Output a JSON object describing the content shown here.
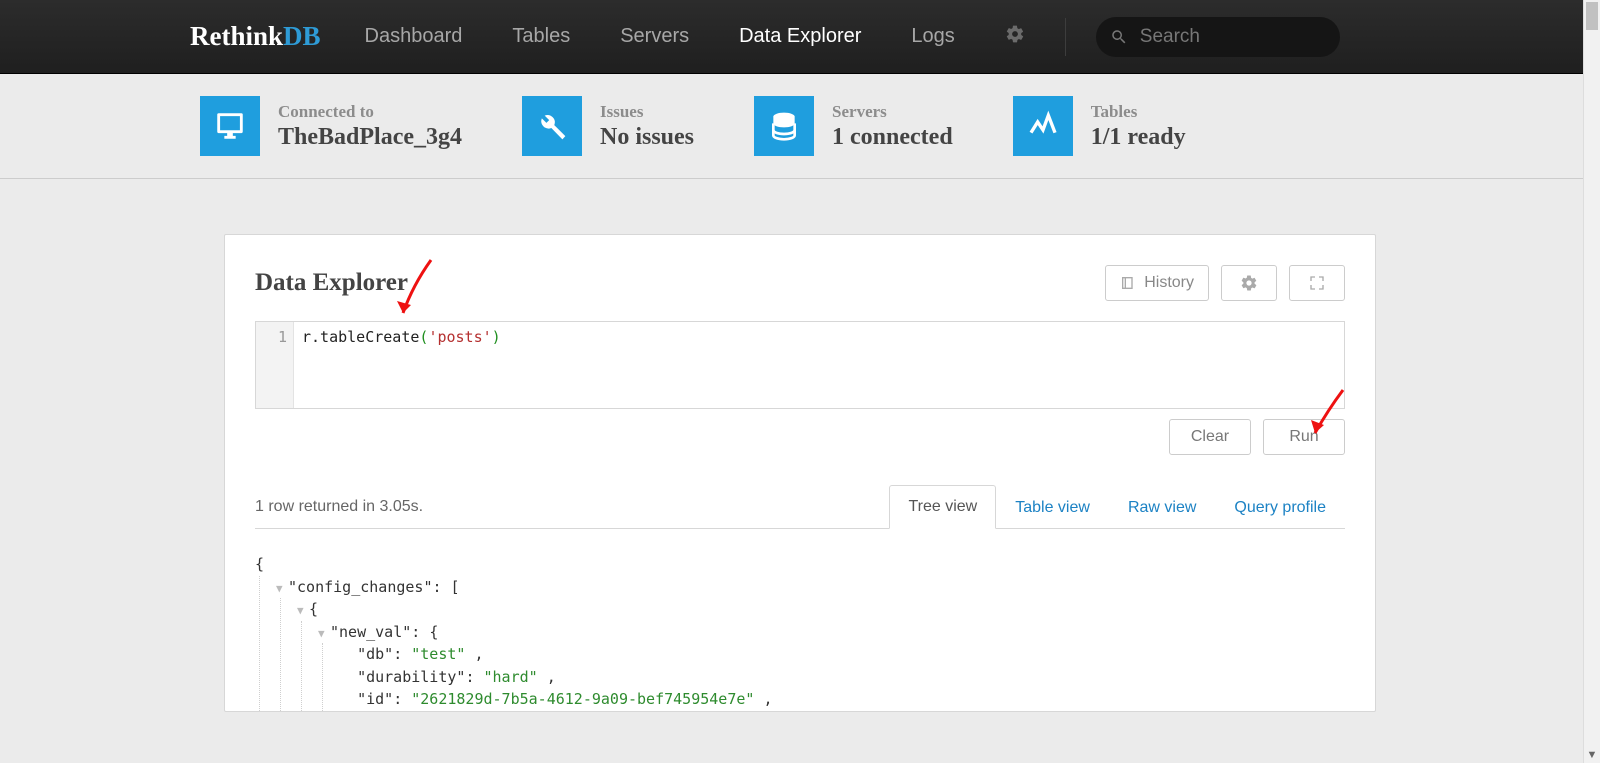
{
  "brand": {
    "prefix": "Rethink",
    "suffix": "DB"
  },
  "nav": {
    "items": [
      {
        "label": "Dashboard"
      },
      {
        "label": "Tables"
      },
      {
        "label": "Servers"
      },
      {
        "label": "Data Explorer"
      },
      {
        "label": "Logs"
      }
    ],
    "active": "Data Explorer",
    "search_placeholder": "Search"
  },
  "status": {
    "connected_label": "Connected to",
    "connected_value": "TheBadPlace_3g4",
    "issues_label": "Issues",
    "issues_value": "No issues",
    "servers_label": "Servers",
    "servers_value": "1 connected",
    "tables_label": "Tables",
    "tables_value": "1/1 ready"
  },
  "panel": {
    "title": "Data Explorer",
    "history_label": "History",
    "clear_label": "Clear",
    "run_label": "Run"
  },
  "editor": {
    "line_number": "1",
    "code_fn": "r.tableCreate",
    "code_open": "(",
    "code_str": "'posts'",
    "code_close": ")"
  },
  "results": {
    "status": "1 row returned in 3.05s.",
    "tabs": {
      "tree": "Tree view",
      "table": "Table view",
      "raw": "Raw view",
      "profile": "Query profile"
    }
  },
  "tree": {
    "open_brace": "{",
    "config_changes_key": "\"config_changes\"",
    "config_changes_open": ": [",
    "inner_brace": "{",
    "new_val_key": "\"new_val\"",
    "new_val_open": ": {",
    "db_key": "\"db\"",
    "db_val": "\"test\"",
    "comma": " ,",
    "durability_key": "\"durability\"",
    "durability_val": "\"hard\"",
    "id_key": "\"id\"",
    "id_val": "\"2621829d-7b5a-4612-9a09-bef745954e7e\""
  }
}
